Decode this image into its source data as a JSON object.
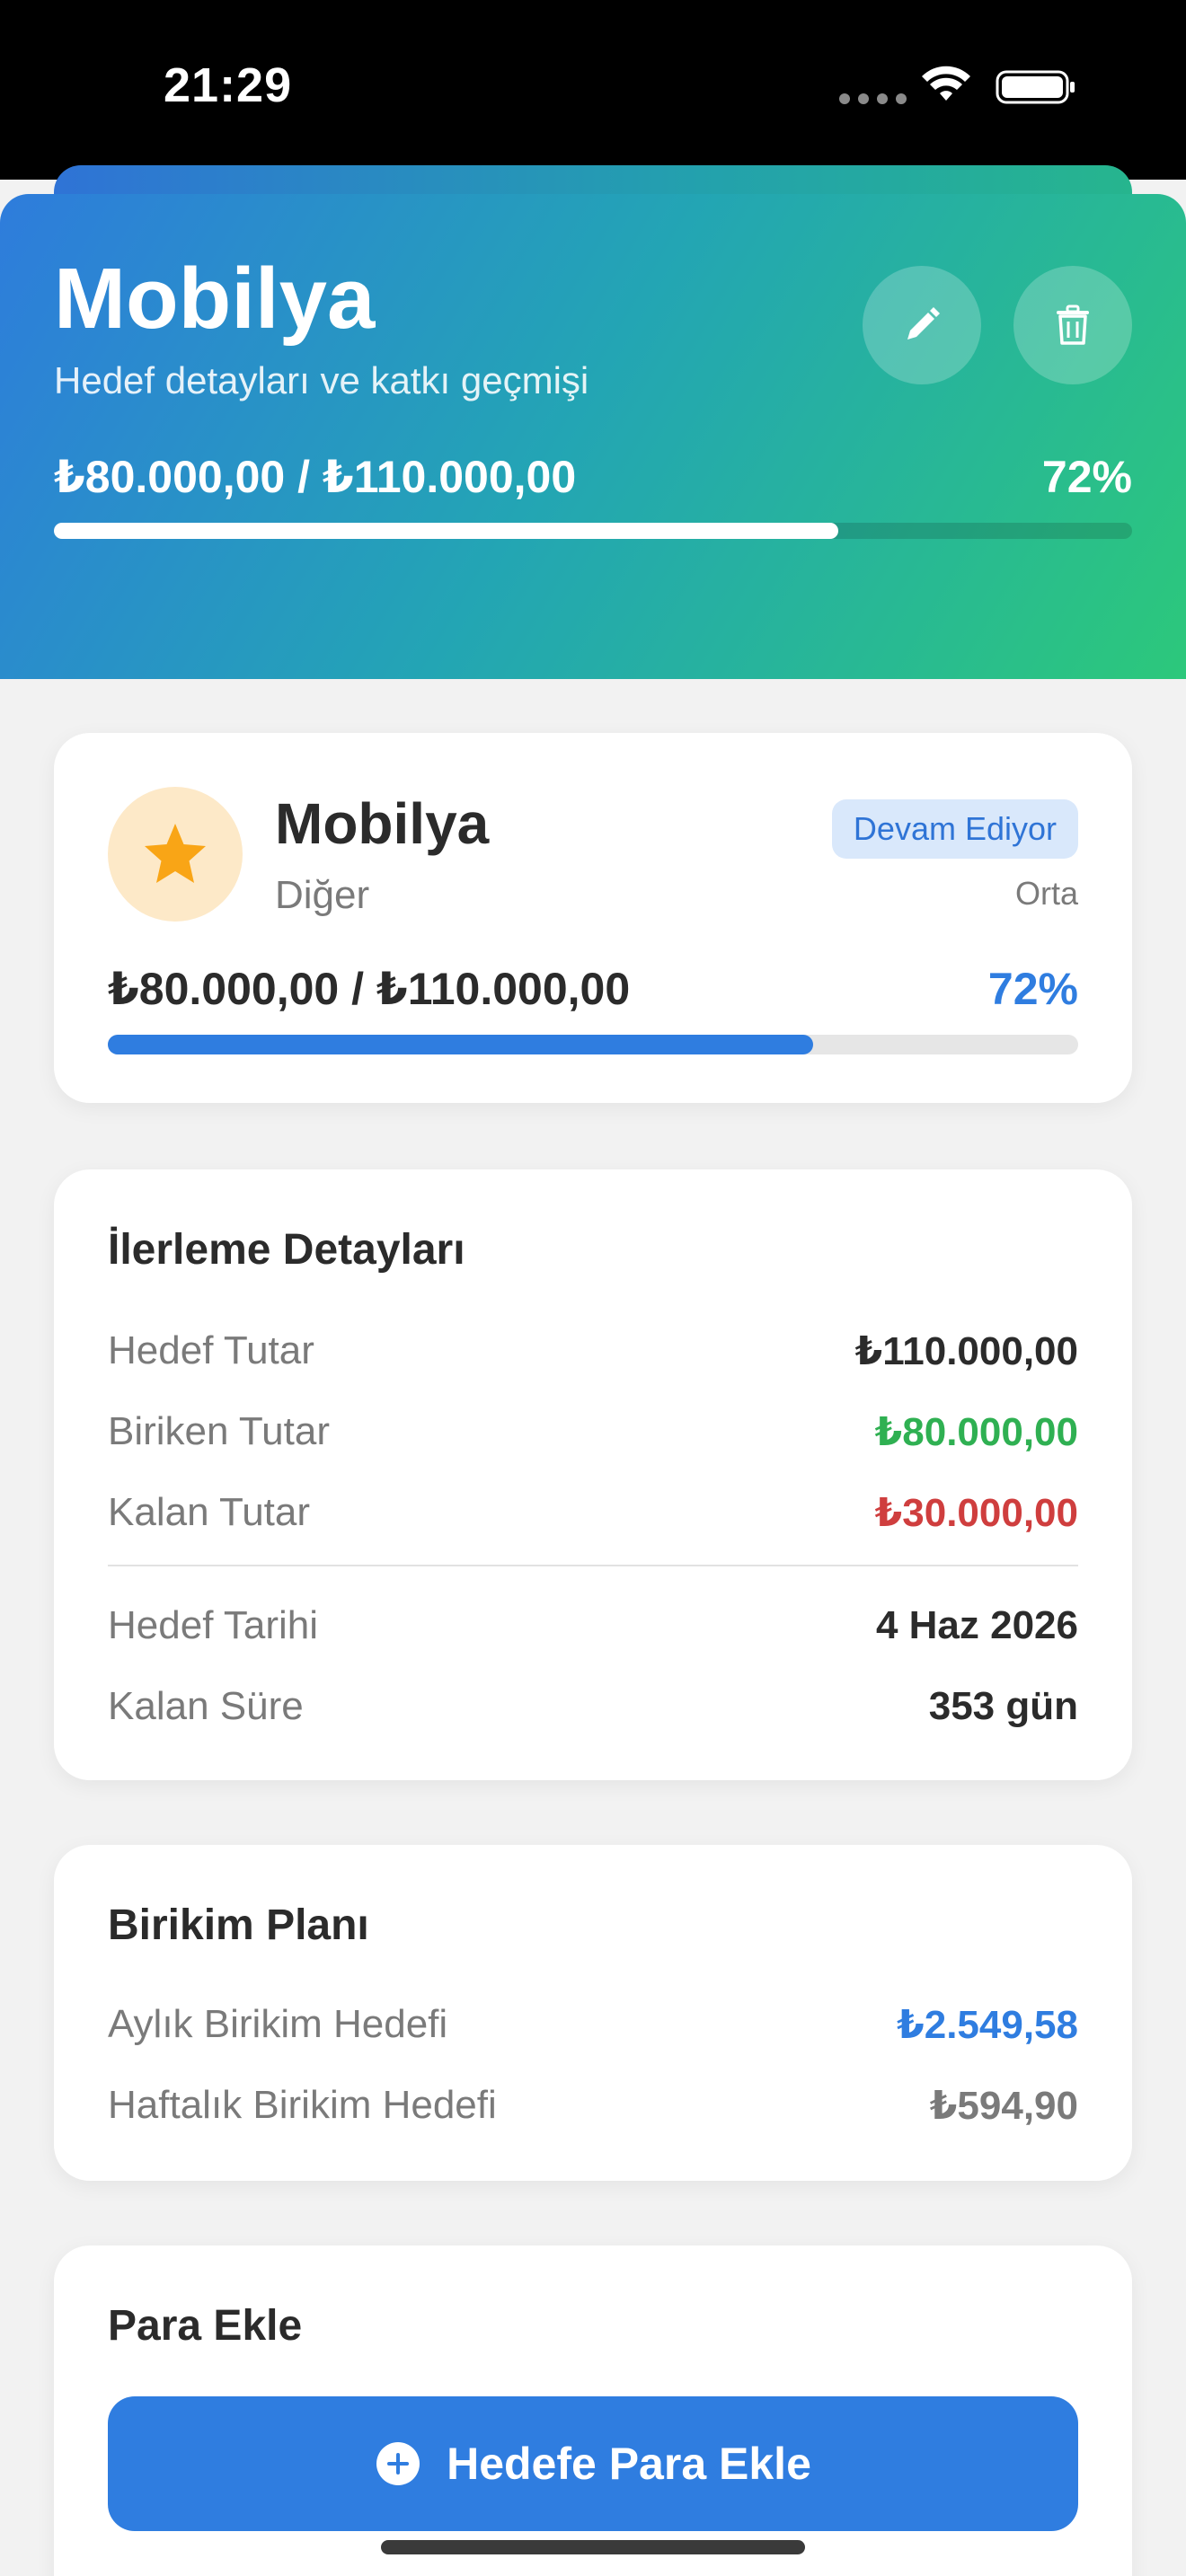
{
  "status_bar": {
    "time": "21:29"
  },
  "header": {
    "title": "Mobilya",
    "subtitle": "Hedef detayları ve katkı geçmişi",
    "amount": "₺80.000,00 / ₺110.000,00",
    "percent_label": "72%",
    "progress": 0.7273,
    "gradient_colors": [
      "#2e7cdc",
      "#23a5b4",
      "#2cc87b"
    ],
    "edit_icon": "pencil-icon",
    "delete_icon": "trash-icon"
  },
  "goal_card": {
    "icon": "star-icon",
    "name": "Mobilya",
    "category": "Diğer",
    "status": "Devam Ediyor",
    "priority": "Orta",
    "amount": "₺80.000,00 / ₺110.000,00",
    "percent_label": "72%",
    "progress": 0.7273
  },
  "details": {
    "title": "İlerleme Detayları",
    "rows": [
      {
        "label": "Hedef Tutar",
        "value": "₺110.000,00",
        "color": "#2b2b2b"
      },
      {
        "label": "Biriken Tutar",
        "value": "₺80.000,00",
        "color": "#2fb052"
      },
      {
        "label": "Kalan Tutar",
        "value": "₺30.000,00",
        "color": "#cf3e3e"
      }
    ],
    "rows2": [
      {
        "label": "Hedef Tarihi",
        "value": "4 Haz 2026",
        "color": "#2b2b2b"
      },
      {
        "label": "Kalan Süre",
        "value": "353 gün",
        "color": "#2b2b2b"
      }
    ]
  },
  "plan": {
    "title": "Birikim Planı",
    "rows": [
      {
        "label": "Aylık Birikim Hedefi",
        "value": "₺2.549,58",
        "color": "#2f7de0"
      },
      {
        "label": "Haftalık Birikim Hedefi",
        "value": "₺594,90",
        "color": "#7a7a7a"
      }
    ]
  },
  "add_money": {
    "title": "Para Ekle",
    "button_label": "Hedefe Para Ekle",
    "button_icon": "plus-circle-icon",
    "accent": "#2f7de0"
  }
}
